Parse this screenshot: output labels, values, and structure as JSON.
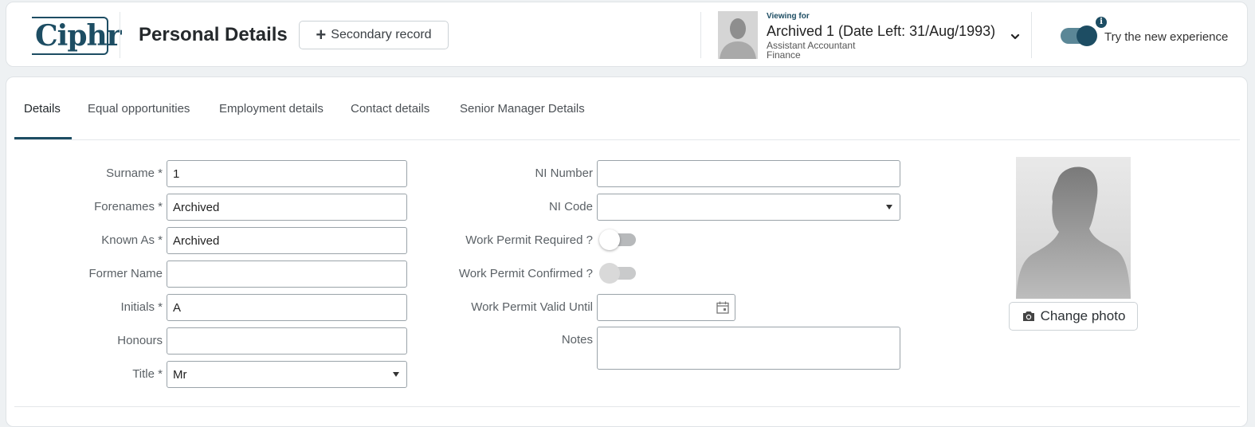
{
  "header": {
    "logo": "Ciphr",
    "title": "Personal Details",
    "secondary_record_label": "Secondary record",
    "viewing_for_label": "Viewing for",
    "viewing_name": "Archived 1 (Date Left: 31/Aug/1993)",
    "viewing_role": "Assistant Accountant",
    "viewing_department": "Finance",
    "try_new_experience_label": "Try the new experience",
    "try_new_experience_on": true
  },
  "tabs": [
    {
      "label": "Details",
      "active": true
    },
    {
      "label": "Equal opportunities",
      "active": false
    },
    {
      "label": "Employment details",
      "active": false
    },
    {
      "label": "Contact details",
      "active": false
    },
    {
      "label": "Senior Manager Details",
      "active": false
    }
  ],
  "left_fields": [
    {
      "label": "Surname *",
      "value": "1",
      "type": "text"
    },
    {
      "label": "Forenames *",
      "value": "Archived",
      "type": "text"
    },
    {
      "label": "Known As *",
      "value": "Archived",
      "type": "text"
    },
    {
      "label": "Former Name",
      "value": "",
      "type": "text"
    },
    {
      "label": "Initials *",
      "value": "A",
      "type": "text"
    },
    {
      "label": "Honours",
      "value": "",
      "type": "text"
    },
    {
      "label": "Title *",
      "value": "Mr",
      "type": "select"
    }
  ],
  "right_fields": {
    "ni_number": {
      "label": "NI Number",
      "value": ""
    },
    "ni_code": {
      "label": "NI Code",
      "value": ""
    },
    "work_permit_required": {
      "label": "Work Permit Required ?",
      "on": false
    },
    "work_permit_confirmed": {
      "label": "Work Permit Confirmed ?",
      "on": false,
      "disabled": true
    },
    "work_permit_valid_until": {
      "label": "Work Permit Valid Until",
      "value": ""
    },
    "notes": {
      "label": "Notes",
      "value": ""
    }
  },
  "photo": {
    "change_label": "Change photo"
  },
  "colors": {
    "brand": "#1d4d63",
    "toggle_track": "#5b8797",
    "border": "#9aa3a9"
  }
}
